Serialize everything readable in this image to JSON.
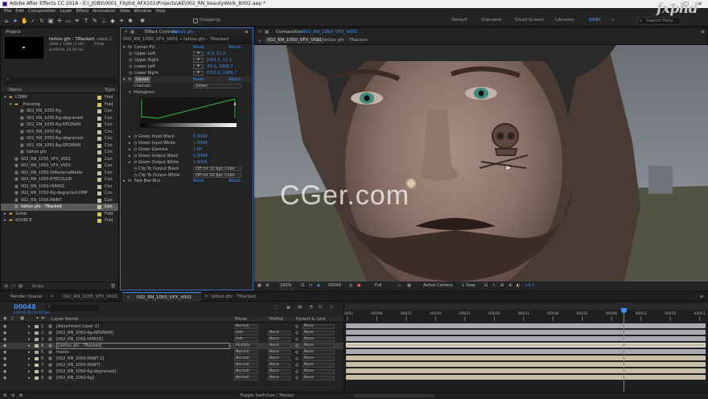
{
  "titlebar": {
    "title": "Adobe After Effects CC 2018 - E:\\_JOBS\\0001_FXphd_AFX101\\Projects\\AE\\002_RN_beautyWork_B002.aep *"
  },
  "brand": {
    "watermark": "fxphd",
    "overlay": "CGer.com"
  },
  "menu": [
    "File",
    "Edit",
    "Composition",
    "Layer",
    "Effect",
    "Animation",
    "View",
    "Window",
    "Help"
  ],
  "toolbar": {
    "snapping": "Snapping",
    "workspaces": [
      "Default",
      "Standard",
      "Small Screen",
      "Libraries",
      "JONO"
    ],
    "active_workspace": "JONO",
    "search_placeholder": "Search Help"
  },
  "project": {
    "tab": "Project",
    "selected_name": "tattoo gfx - TRacked",
    "used_times": ", used 1 time",
    "info1": "2048 x 1080 (1.00)",
    "info2": "Δ 00049, 24.00 fps",
    "col_name": "Name",
    "col_type": "Type",
    "bpc": "32 bpc",
    "items": [
      {
        "name": "COMP",
        "indent": 0,
        "kind": "folder",
        "type": "Fold",
        "color": "#e0c050"
      },
      {
        "name": "_Precomp",
        "indent": 1,
        "kind": "folder",
        "type": "Fold",
        "color": "#e0c050"
      },
      {
        "name": "002_RN_1035-Rg",
        "indent": 2,
        "kind": "comp",
        "type": "Con",
        "color": "#c8c0a0"
      },
      {
        "name": "002_RN_1035-Rg-degrained",
        "indent": 2,
        "kind": "comp",
        "type": "Con",
        "color": "#c8c0a0"
      },
      {
        "name": "002_RN_1035-Rg-REGRAIN",
        "indent": 2,
        "kind": "comp",
        "type": "Con",
        "color": "#c8c0a0"
      },
      {
        "name": "002_RN_1050-Rg",
        "indent": 2,
        "kind": "comp",
        "type": "Con",
        "color": "#c8c0a0"
      },
      {
        "name": "002_RN_1050-Rg-degrained",
        "indent": 2,
        "kind": "comp",
        "type": "Con",
        "color": "#c8c0a0"
      },
      {
        "name": "002_RN_1050-Rg-REGRAIN",
        "indent": 2,
        "kind": "comp",
        "type": "Con",
        "color": "#c8c0a0"
      },
      {
        "name": "tattoo gfx",
        "indent": 2,
        "kind": "comp",
        "type": "Con",
        "color": "#c8c0a0"
      },
      {
        "name": "002_RN_1035_VFX_V001",
        "indent": 1,
        "kind": "comp",
        "type": "Con",
        "color": "#c8c0a0"
      },
      {
        "name": "002_RN_1050_VFX_V001",
        "indent": 1,
        "kind": "comp",
        "type": "Con",
        "color": "#c8c0a0"
      },
      {
        "name": "002_RN_1050-DifferenceMatte",
        "indent": 1,
        "kind": "comp",
        "type": "Con",
        "color": "#c8c0a0"
      },
      {
        "name": "002_RN_1050-EYECOLOR",
        "indent": 1,
        "kind": "comp",
        "type": "Con",
        "color": "#c8c0a0"
      },
      {
        "name": "002_RN_1050-HIPASS",
        "indent": 1,
        "kind": "comp",
        "type": "Con",
        "color": "#c8c0a0"
      },
      {
        "name": "002_RN_1050-Rg-degrained-DMP",
        "indent": 1,
        "kind": "comp",
        "type": "Con",
        "color": "#c8c0a0"
      },
      {
        "name": "002_RN_1050-PAINT",
        "indent": 1,
        "kind": "comp",
        "type": "Con",
        "color": "#c8c0a0"
      },
      {
        "name": "tattoo gfx - TRacked",
        "indent": 1,
        "kind": "comp",
        "type": "Con",
        "color": "#c8c0a0",
        "selected": true
      },
      {
        "name": "Solids",
        "indent": 0,
        "kind": "folder",
        "type": "Fold",
        "color": "#e0c050"
      },
      {
        "name": "SOURCE",
        "indent": 0,
        "kind": "folder",
        "type": "Fold",
        "color": "#e0c050"
      }
    ]
  },
  "effects": {
    "tab": "Effect Controls",
    "tab_target": "tattoo gfx",
    "header": "002_RN_1050_VFX_V001 • tattoo gfx - TRacked",
    "reset": "Reset",
    "about": "About...",
    "corner_pin": {
      "name": "Corner Pin",
      "rows": [
        {
          "label": "Upper Left",
          "value": "-5.9, 11.3"
        },
        {
          "label": "Upper Right",
          "value": "2083.5, 11.3"
        },
        {
          "label": "Lower Left",
          "value": "-45.0, 1068.7"
        },
        {
          "label": "Lower Right",
          "value": "2053.9, 1068.7"
        }
      ]
    },
    "levels": {
      "name": "Levels",
      "channel_label": "Channel:",
      "channel_value": "Green",
      "histogram_label": "Histogram",
      "rows": [
        {
          "label": "Green Input Black",
          "value": "0.0000"
        },
        {
          "label": "Green Input White",
          "value": "1.0000"
        },
        {
          "label": "Green Gamma",
          "value": "1.00"
        },
        {
          "label": "Green Output Black",
          "value": "0.0044"
        },
        {
          "label": "Green Output White",
          "value": "1.0000"
        }
      ],
      "clip_rows": [
        {
          "label": "Clip To Output Black",
          "value": "Off for 32 bpc Color"
        },
        {
          "label": "Clip To Output White",
          "value": "Off for 32 bpc Color"
        }
      ]
    },
    "fast_box_blur": {
      "name": "Fast Box Blur"
    }
  },
  "composition": {
    "tab": "Composition",
    "tab_target": "002_RN_1050_VFX_V001",
    "breadcrumbs": [
      "002_RN_1050_VFX_V001",
      "tattoo gfx - TRacked"
    ],
    "zoom": "100%",
    "timecode": "00048",
    "resolution": "Full",
    "camera": "Active Camera",
    "views": "1 View",
    "exposure": "+0.0"
  },
  "timeline": {
    "tabs": [
      "Render Queue",
      "002_RN_1035_VFX_V001",
      "002_RN_1050_VFX_V001",
      "tattoo gfx - TRacked"
    ],
    "active_tab": "002_RN_1050_VFX_V001",
    "current_time": "00048",
    "time_sub": "0:00:02:00 (24.00 fps)",
    "col_layer": "Layer Name",
    "col_mode": "Mode",
    "col_trkmat": "TrkMat",
    "col_parent": "Parent & Link",
    "ruler": [
      "00001",
      "00006",
      "00011",
      "00016",
      "00021",
      "00026",
      "00031",
      "00036",
      "00041",
      "00046",
      "00051",
      "00056",
      "00061"
    ],
    "playhead_frame": 48,
    "ruler_start": 1,
    "ruler_end": 62,
    "toggle_label": "Toggle Switches / Modes",
    "layers": [
      {
        "num": "1",
        "name": "[Adjustment Layer 2]",
        "mode": "Normal",
        "trk": "",
        "parent": "None",
        "bar": "#a8a8ad"
      },
      {
        "num": "2",
        "name": "[002_RN_1050-Rg-REGRAIN]",
        "mode": "Add",
        "trk": "None",
        "parent": "None",
        "bar": "#a8a8ad"
      },
      {
        "num": "3",
        "name": "[002_RN_1050-HIPASS]",
        "mode": "Add",
        "trk": "None",
        "parent": "None",
        "bar": "#a8a8ad"
      },
      {
        "num": "4",
        "name": "[tattoo gfx - TRacked]",
        "mode": "Multiply",
        "trk": "None",
        "parent": "None",
        "bar": "#c7bfa8",
        "selected": true
      },
      {
        "num": "5",
        "name": "masks",
        "mode": "Normal",
        "trk": "None",
        "parent": "None",
        "bar": "#a8a8ad"
      },
      {
        "num": "6",
        "name": "[002_RN_1050-PAINT 2]",
        "mode": "Normal",
        "trk": "None",
        "parent": "None",
        "bar": "#c7bfa8"
      },
      {
        "num": "7",
        "name": "[002_RN_1050-PAINT]",
        "mode": "Normal",
        "trk": "None",
        "parent": "None",
        "bar": "#c7bfa8"
      },
      {
        "num": "8",
        "name": "[002_RN_1050-Rg-degrained]",
        "mode": "Normal",
        "trk": "None",
        "parent": "None",
        "bar": "#c7bfa8"
      },
      {
        "num": "9",
        "name": "[002_RN_1050-Rg]",
        "mode": "Normal",
        "trk": "None",
        "parent": "None",
        "bar": "#c7bfa8"
      }
    ]
  },
  "colors": {
    "accent": "#3f8ef0",
    "panel": "#232323",
    "selection": "#5a5a5a",
    "timecode": "#3f8ef0"
  }
}
